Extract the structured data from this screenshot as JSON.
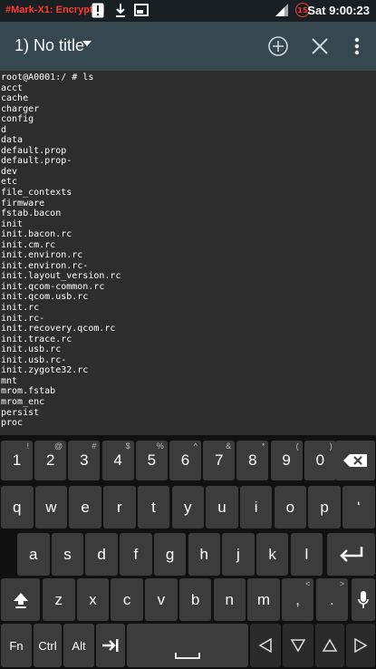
{
  "status": {
    "encrypted_label": "#Mark-X1: Encrypted",
    "time": "Sat 9:00:23",
    "notification_count": "15",
    "accent": "#ff3b30"
  },
  "toolbar": {
    "title": "1) No title",
    "add_icon": "plus-circle-icon",
    "close_icon": "close-icon",
    "menu_icon": "overflow-menu-icon",
    "bg": "#37474f"
  },
  "terminal": {
    "lines": [
      "root@A0001:/ # ls",
      "acct",
      "cache",
      "charger",
      "config",
      "d",
      "data",
      "default.prop",
      "default.prop-",
      "dev",
      "etc",
      "file_contexts",
      "firmware",
      "fstab.bacon",
      "init",
      "init.bacon.rc",
      "init.cm.rc",
      "init.environ.rc",
      "init.environ.rc-",
      "init.layout_version.rc",
      "init.qcom-common.rc",
      "init.qcom.usb.rc",
      "init.rc",
      "init.rc-",
      "init.recovery.qcom.rc",
      "init.trace.rc",
      "init.usb.rc",
      "init.usb.rc-",
      "init.zygote32.rc",
      "mnt",
      "mrom.fstab",
      "mrom_enc",
      "persist",
      "proc"
    ],
    "bg": "#2d2d2d"
  },
  "keyboard": {
    "row1": [
      {
        "k": "1",
        "s": "!"
      },
      {
        "k": "2",
        "s": "@"
      },
      {
        "k": "3",
        "s": "#"
      },
      {
        "k": "4",
        "s": "$"
      },
      {
        "k": "5",
        "s": "%"
      },
      {
        "k": "6",
        "s": "^"
      },
      {
        "k": "7",
        "s": "&"
      },
      {
        "k": "8",
        "s": "*"
      },
      {
        "k": "9",
        "s": "("
      },
      {
        "k": "0",
        "s": ")"
      }
    ],
    "row2": [
      "q",
      "w",
      "e",
      "r",
      "t",
      "y",
      "u",
      "i",
      "o",
      "p",
      "'"
    ],
    "row3": [
      "a",
      "s",
      "d",
      "f",
      "g",
      "h",
      "j",
      "k",
      "l"
    ],
    "row4": [
      "z",
      "x",
      "c",
      "v",
      "b",
      "n",
      "m",
      ",",
      "."
    ],
    "row4_subs": [
      "",
      "",
      "",
      "",
      "",
      "",
      "",
      "<",
      ">"
    ],
    "fn_label": "Fn",
    "ctrl_label": "Ctrl",
    "alt_label": "Alt"
  }
}
